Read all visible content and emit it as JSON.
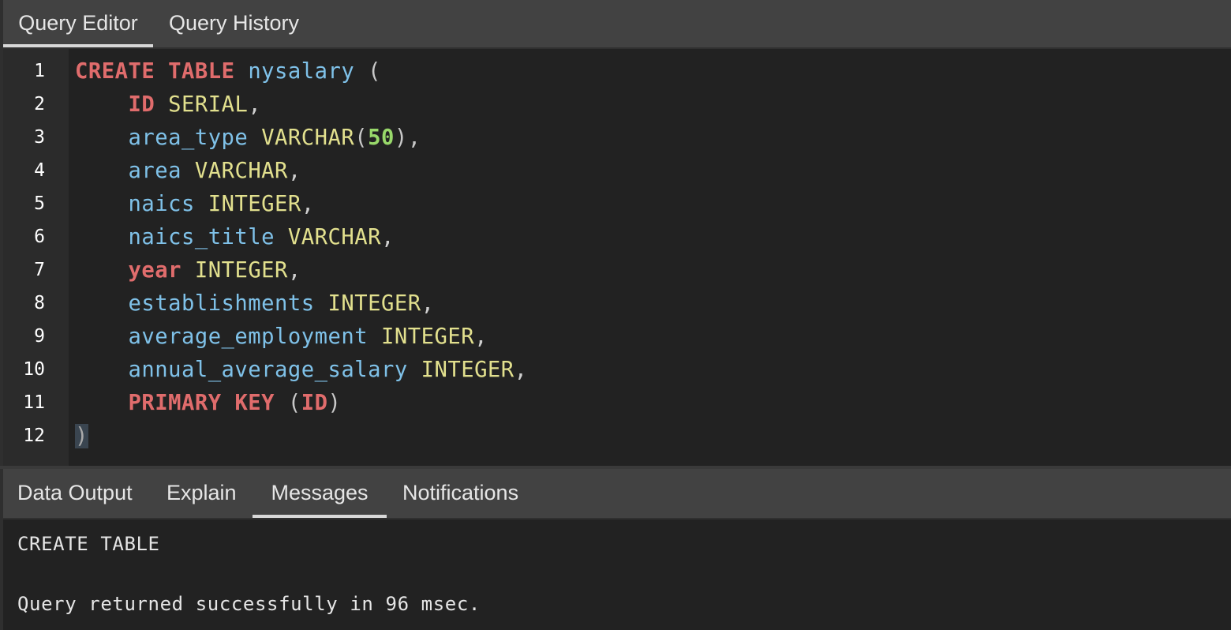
{
  "top_tabs": [
    {
      "label": "Query Editor",
      "active": true
    },
    {
      "label": "Query History",
      "active": false
    }
  ],
  "editor": {
    "line_numbers": [
      "1",
      "2",
      "3",
      "4",
      "5",
      "6",
      "7",
      "8",
      "9",
      "10",
      "11",
      "12"
    ],
    "code_lines": [
      [
        {
          "t": "CREATE",
          "c": "kw"
        },
        {
          "t": " ",
          "c": "pn"
        },
        {
          "t": "TABLE",
          "c": "kw"
        },
        {
          "t": " ",
          "c": "pn"
        },
        {
          "t": "nysalary",
          "c": "id"
        },
        {
          "t": " (",
          "c": "pp"
        }
      ],
      [
        {
          "t": "    ",
          "c": "pn"
        },
        {
          "t": "ID",
          "c": "kw"
        },
        {
          "t": " ",
          "c": "pn"
        },
        {
          "t": "SERIAL",
          "c": "ty"
        },
        {
          "t": ",",
          "c": "pn"
        }
      ],
      [
        {
          "t": "    ",
          "c": "pn"
        },
        {
          "t": "area_type",
          "c": "id"
        },
        {
          "t": " ",
          "c": "pn"
        },
        {
          "t": "VARCHAR",
          "c": "ty"
        },
        {
          "t": "(",
          "c": "pp"
        },
        {
          "t": "50",
          "c": "num"
        },
        {
          "t": "),",
          "c": "pp"
        }
      ],
      [
        {
          "t": "    ",
          "c": "pn"
        },
        {
          "t": "area",
          "c": "id"
        },
        {
          "t": " ",
          "c": "pn"
        },
        {
          "t": "VARCHAR",
          "c": "ty"
        },
        {
          "t": ",",
          "c": "pn"
        }
      ],
      [
        {
          "t": "    ",
          "c": "pn"
        },
        {
          "t": "naics",
          "c": "id"
        },
        {
          "t": " ",
          "c": "pn"
        },
        {
          "t": "INTEGER",
          "c": "ty"
        },
        {
          "t": ",",
          "c": "pn"
        }
      ],
      [
        {
          "t": "    ",
          "c": "pn"
        },
        {
          "t": "naics_title",
          "c": "id"
        },
        {
          "t": " ",
          "c": "pn"
        },
        {
          "t": "VARCHAR",
          "c": "ty"
        },
        {
          "t": ",",
          "c": "pn"
        }
      ],
      [
        {
          "t": "    ",
          "c": "pn"
        },
        {
          "t": "year",
          "c": "kw"
        },
        {
          "t": " ",
          "c": "pn"
        },
        {
          "t": "INTEGER",
          "c": "ty"
        },
        {
          "t": ",",
          "c": "pn"
        }
      ],
      [
        {
          "t": "    ",
          "c": "pn"
        },
        {
          "t": "establishments",
          "c": "id"
        },
        {
          "t": " ",
          "c": "pn"
        },
        {
          "t": "INTEGER",
          "c": "ty"
        },
        {
          "t": ",",
          "c": "pn"
        }
      ],
      [
        {
          "t": "    ",
          "c": "pn"
        },
        {
          "t": "average_employment",
          "c": "id"
        },
        {
          "t": " ",
          "c": "pn"
        },
        {
          "t": "INTEGER",
          "c": "ty"
        },
        {
          "t": ",",
          "c": "pn"
        }
      ],
      [
        {
          "t": "    ",
          "c": "pn"
        },
        {
          "t": "annual_average_salary",
          "c": "id"
        },
        {
          "t": " ",
          "c": "pn"
        },
        {
          "t": "INTEGER",
          "c": "ty"
        },
        {
          "t": ",",
          "c": "pn"
        }
      ],
      [
        {
          "t": "    ",
          "c": "pn"
        },
        {
          "t": "PRIMARY",
          "c": "kw"
        },
        {
          "t": " ",
          "c": "pn"
        },
        {
          "t": "KEY",
          "c": "kw"
        },
        {
          "t": " (",
          "c": "pp"
        },
        {
          "t": "ID",
          "c": "kw"
        },
        {
          "t": ")",
          "c": "pp"
        }
      ],
      [
        {
          "t": ")",
          "c": "cursor-paren"
        }
      ]
    ]
  },
  "bottom_tabs": [
    {
      "label": "Data Output",
      "active": false
    },
    {
      "label": "Explain",
      "active": false
    },
    {
      "label": "Messages",
      "active": true
    },
    {
      "label": "Notifications",
      "active": false
    }
  ],
  "messages": {
    "line1": "CREATE TABLE",
    "line2": "Query returned successfully in 96 msec."
  },
  "colors": {
    "keyword": "#e06c6c",
    "type": "#e2e08e",
    "identifier": "#7fc1e8",
    "number": "#98d86a",
    "background": "#222222",
    "tab_bar": "#424242"
  }
}
